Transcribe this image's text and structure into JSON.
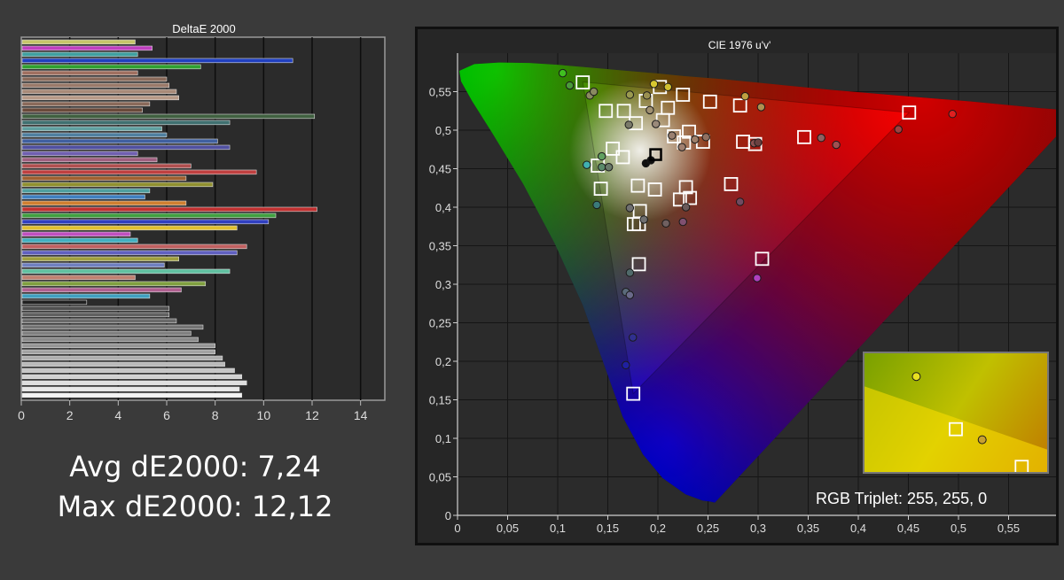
{
  "colors": {
    "background": "#3a3a3a",
    "panel": "#262626",
    "plot_bg": "#2b2b2b",
    "grid": "#111111",
    "text": "#ffffff",
    "tick_text": "#dddddd"
  },
  "stats": {
    "avg": "Avg dE2000: 7,24",
    "max": "Max dE2000: 12,12"
  },
  "chart_data": [
    {
      "type": "bar",
      "orientation": "horizontal",
      "title": "DeltaE 2000",
      "xlim": [
        0,
        15
      ],
      "x_ticks": [
        "0",
        "2",
        "4",
        "6",
        "8",
        "10",
        "12",
        "14"
      ],
      "grid": true,
      "bars": [
        {
          "value": 4.7,
          "color": "#c6c66a"
        },
        {
          "value": 5.4,
          "color": "#c040c0"
        },
        {
          "value": 4.8,
          "color": "#40a0a0"
        },
        {
          "value": 11.2,
          "color": "#2040c0"
        },
        {
          "value": 7.4,
          "color": "#30a030"
        },
        {
          "value": 4.8,
          "color": "#a07060"
        },
        {
          "value": 6.0,
          "color": "#8a6a5a"
        },
        {
          "value": 6.1,
          "color": "#9a7a6a"
        },
        {
          "value": 6.4,
          "color": "#a88a78"
        },
        {
          "value": 6.5,
          "color": "#b89a88"
        },
        {
          "value": 5.3,
          "color": "#8a6a5a"
        },
        {
          "value": 5.0,
          "color": "#6a4a3a"
        },
        {
          "value": 12.1,
          "color": "#406040"
        },
        {
          "value": 8.6,
          "color": "#407070"
        },
        {
          "value": 5.8,
          "color": "#60a0a0"
        },
        {
          "value": 6.0,
          "color": "#5080a0"
        },
        {
          "value": 8.1,
          "color": "#4060a0"
        },
        {
          "value": 8.6,
          "color": "#5050a0"
        },
        {
          "value": 4.8,
          "color": "#7060b0"
        },
        {
          "value": 5.6,
          "color": "#a06080"
        },
        {
          "value": 7.0,
          "color": "#b05050"
        },
        {
          "value": 9.7,
          "color": "#c04040"
        },
        {
          "value": 6.8,
          "color": "#a06030"
        },
        {
          "value": 7.9,
          "color": "#909030"
        },
        {
          "value": 5.3,
          "color": "#50a0a0"
        },
        {
          "value": 5.1,
          "color": "#4080c0"
        },
        {
          "value": 6.8,
          "color": "#d08030"
        },
        {
          "value": 12.2,
          "color": "#c03030"
        },
        {
          "value": 10.5,
          "color": "#40a040"
        },
        {
          "value": 10.2,
          "color": "#3040c0"
        },
        {
          "value": 8.9,
          "color": "#e0c030"
        },
        {
          "value": 4.5,
          "color": "#c050c0"
        },
        {
          "value": 4.8,
          "color": "#40b0c0"
        },
        {
          "value": 9.3,
          "color": "#c06060"
        },
        {
          "value": 8.9,
          "color": "#6060c0"
        },
        {
          "value": 6.5,
          "color": "#a0a040"
        },
        {
          "value": 5.9,
          "color": "#7080c0"
        },
        {
          "value": 8.6,
          "color": "#60c0a0"
        },
        {
          "value": 4.7,
          "color": "#c08070"
        },
        {
          "value": 7.6,
          "color": "#80a040"
        },
        {
          "value": 6.6,
          "color": "#b06090"
        },
        {
          "value": 5.3,
          "color": "#40a0c0"
        },
        {
          "value": 2.7,
          "color": "#202020"
        },
        {
          "value": 6.1,
          "color": "#505050"
        },
        {
          "value": 6.1,
          "color": "#606060"
        },
        {
          "value": 6.4,
          "color": "#6a6a6a"
        },
        {
          "value": 7.5,
          "color": "#747474"
        },
        {
          "value": 7.0,
          "color": "#808080"
        },
        {
          "value": 7.3,
          "color": "#8a8a8a"
        },
        {
          "value": 8.0,
          "color": "#969696"
        },
        {
          "value": 8.0,
          "color": "#a2a2a2"
        },
        {
          "value": 8.3,
          "color": "#aeaeae"
        },
        {
          "value": 8.4,
          "color": "#bababa"
        },
        {
          "value": 8.8,
          "color": "#c6c6c6"
        },
        {
          "value": 9.1,
          "color": "#d2d2d2"
        },
        {
          "value": 9.3,
          "color": "#dedede"
        },
        {
          "value": 9.0,
          "color": "#e8e8e8"
        },
        {
          "value": 9.1,
          "color": "#f4f4f4"
        }
      ]
    },
    {
      "type": "scatter",
      "title": "CIE 1976 u'v'",
      "xlim": [
        0,
        0.6
      ],
      "ylim": [
        0,
        0.6
      ],
      "x_ticks": [
        "0",
        "0,05",
        "0,1",
        "0,15",
        "0,2",
        "0,25",
        "0,3",
        "0,35",
        "0,4",
        "0,45",
        "0,5",
        "0,55"
      ],
      "y_ticks": [
        "0",
        "0,05",
        "0,1",
        "0,15",
        "0,2",
        "0,25",
        "0,3",
        "0,35",
        "0,4",
        "0,45",
        "0,5",
        "0,55"
      ],
      "grid": true,
      "gamut": [
        [
          0.4507,
          0.5229
        ],
        [
          0.125,
          0.5625
        ],
        [
          0.1754,
          0.1579
        ]
      ],
      "whitepoint": [
        0.1978,
        0.4683
      ],
      "targets": [
        [
          0.125,
          0.562
        ],
        [
          0.202,
          0.556
        ],
        [
          0.225,
          0.546
        ],
        [
          0.188,
          0.538
        ],
        [
          0.148,
          0.525
        ],
        [
          0.166,
          0.525
        ],
        [
          0.21,
          0.529
        ],
        [
          0.252,
          0.537
        ],
        [
          0.282,
          0.532
        ],
        [
          0.178,
          0.509
        ],
        [
          0.205,
          0.513
        ],
        [
          0.231,
          0.498
        ],
        [
          0.216,
          0.492
        ],
        [
          0.226,
          0.484
        ],
        [
          0.245,
          0.485
        ],
        [
          0.285,
          0.485
        ],
        [
          0.297,
          0.482
        ],
        [
          0.346,
          0.491
        ],
        [
          0.4507,
          0.5229
        ],
        [
          0.155,
          0.476
        ],
        [
          0.165,
          0.465
        ],
        [
          0.14,
          0.454
        ],
        [
          0.18,
          0.428
        ],
        [
          0.197,
          0.423
        ],
        [
          0.143,
          0.424
        ],
        [
          0.228,
          0.426
        ],
        [
          0.273,
          0.43
        ],
        [
          0.232,
          0.412
        ],
        [
          0.222,
          0.41
        ],
        [
          0.182,
          0.395
        ],
        [
          0.176,
          0.378
        ],
        [
          0.181,
          0.378
        ],
        [
          0.304,
          0.333
        ],
        [
          0.181,
          0.326
        ],
        [
          0.1754,
          0.1579
        ]
      ],
      "measured": [
        [
          0.105,
          0.574,
          "#40c020"
        ],
        [
          0.112,
          0.558,
          "#4a9a3a"
        ],
        [
          0.132,
          0.545,
          "#8a8a60"
        ],
        [
          0.136,
          0.55,
          "#8a8a60"
        ],
        [
          0.196,
          0.56,
          "#d8c830"
        ],
        [
          0.21,
          0.556,
          "#d0c030"
        ],
        [
          0.172,
          0.546,
          "#9a9a50"
        ],
        [
          0.189,
          0.545,
          "#9a9050"
        ],
        [
          0.287,
          0.544,
          "#c0a040"
        ],
        [
          0.303,
          0.53,
          "#b09050"
        ],
        [
          0.192,
          0.526,
          "#a09070"
        ],
        [
          0.171,
          0.507,
          "#7a7a6a"
        ],
        [
          0.198,
          0.508,
          "#9a8a7a"
        ],
        [
          0.214,
          0.493,
          "#9a8070"
        ],
        [
          0.224,
          0.478,
          "#a08070"
        ],
        [
          0.237,
          0.488,
          "#a0806a"
        ],
        [
          0.248,
          0.491,
          "#907060"
        ],
        [
          0.296,
          0.483,
          "#8a5050"
        ],
        [
          0.3,
          0.484,
          "#6a4040"
        ],
        [
          0.363,
          0.49,
          "#906060"
        ],
        [
          0.378,
          0.481,
          "#a05050"
        ],
        [
          0.44,
          0.501,
          "#a04040"
        ],
        [
          0.494,
          0.521,
          "#e02020"
        ],
        [
          0.144,
          0.466,
          "#60a060"
        ],
        [
          0.129,
          0.455,
          "#40b0b0"
        ],
        [
          0.144,
          0.452,
          "#5a8a6a"
        ],
        [
          0.151,
          0.452,
          "#6a7a6a"
        ],
        [
          0.188,
          0.457,
          "#101010"
        ],
        [
          0.193,
          0.461,
          "#101010"
        ],
        [
          0.139,
          0.403,
          "#3a7a7a"
        ],
        [
          0.172,
          0.399,
          "#707070"
        ],
        [
          0.186,
          0.384,
          "#707070"
        ],
        [
          0.208,
          0.379,
          "#706060"
        ],
        [
          0.225,
          0.381,
          "#805070"
        ],
        [
          0.228,
          0.4,
          "#6a5a5a"
        ],
        [
          0.282,
          0.407,
          "#704a60"
        ],
        [
          0.299,
          0.308,
          "#b040c0"
        ],
        [
          0.172,
          0.315,
          "#506a6a"
        ],
        [
          0.168,
          0.29,
          "#5a6a7a"
        ],
        [
          0.172,
          0.286,
          "#6a6a8a"
        ],
        [
          0.175,
          0.231,
          "#303090"
        ],
        [
          0.168,
          0.195,
          "#2020a0"
        ]
      ],
      "inset": {
        "targets": [
          [
            0.5,
            0.519
          ],
          [
            0.55,
            0.494
          ]
        ],
        "measured": [
          [
            0.47,
            0.554,
            "#e8e020"
          ],
          [
            0.52,
            0.512,
            "#c8a030"
          ]
        ]
      },
      "readout": "RGB Triplet: 255, 255, 0"
    }
  ]
}
